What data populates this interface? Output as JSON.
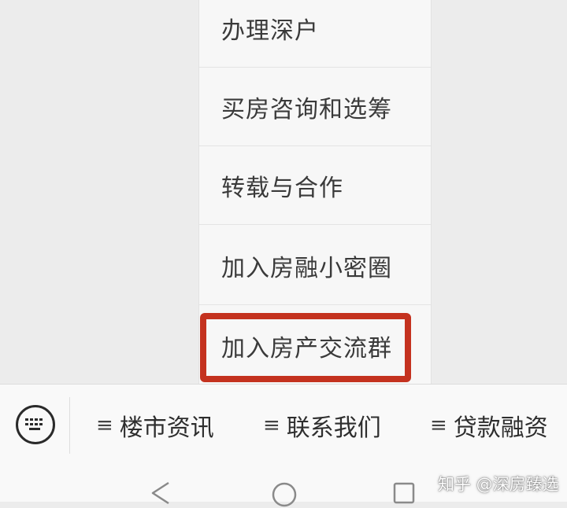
{
  "menu": {
    "items": [
      {
        "label": "办理深户"
      },
      {
        "label": "买房咨询和选筹"
      },
      {
        "label": "转载与合作"
      },
      {
        "label": "加入房融小密圈"
      },
      {
        "label": "加入房产交流群"
      }
    ],
    "highlighted_index": 4,
    "highlight_color": "#c4321f"
  },
  "bottom_bar": {
    "keyboard_icon": "keyboard-icon",
    "tab_icon": "menu-lines-icon",
    "tab_glyph": "≡",
    "tabs": [
      {
        "label": "楼市资讯"
      },
      {
        "label": "联系我们"
      },
      {
        "label": "贷款融资"
      }
    ]
  },
  "navigation": {
    "back_icon": "triangle-back-icon",
    "home_icon": "circle-home-icon",
    "recents_icon": "square-recents-icon"
  },
  "watermark": {
    "text": "知乎 @深房臻选"
  }
}
